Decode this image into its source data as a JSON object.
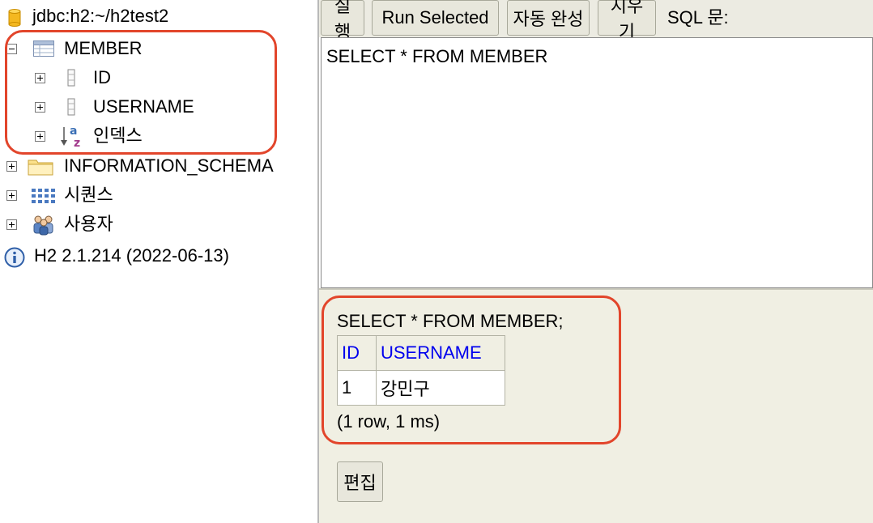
{
  "tree": {
    "connection": "jdbc:h2:~/h2test2",
    "table": {
      "name": "MEMBER",
      "columns": [
        "ID",
        "USERNAME"
      ],
      "indexes_label": "인덱스"
    },
    "schema": "INFORMATION_SCHEMA",
    "sequences": "시퀀스",
    "users": "사용자",
    "version": "H2 2.1.214 (2022-06-13)"
  },
  "toolbar": {
    "run": "실행",
    "run_selected": "Run Selected",
    "autocomplete": "자동 완성",
    "clear": "지우기",
    "sql_label": "SQL 문:"
  },
  "editor": {
    "sql": "SELECT * FROM MEMBER"
  },
  "result": {
    "query": "SELECT * FROM MEMBER;",
    "columns": [
      "ID",
      "USERNAME"
    ],
    "rows": [
      [
        "1",
        "강민구"
      ]
    ],
    "summary": "(1 row, 1 ms)",
    "edit_button": "편집"
  },
  "colors": {
    "highlight": "#e2452b",
    "header_link": "#0000ee",
    "panel_bg": "#f0efe3"
  }
}
